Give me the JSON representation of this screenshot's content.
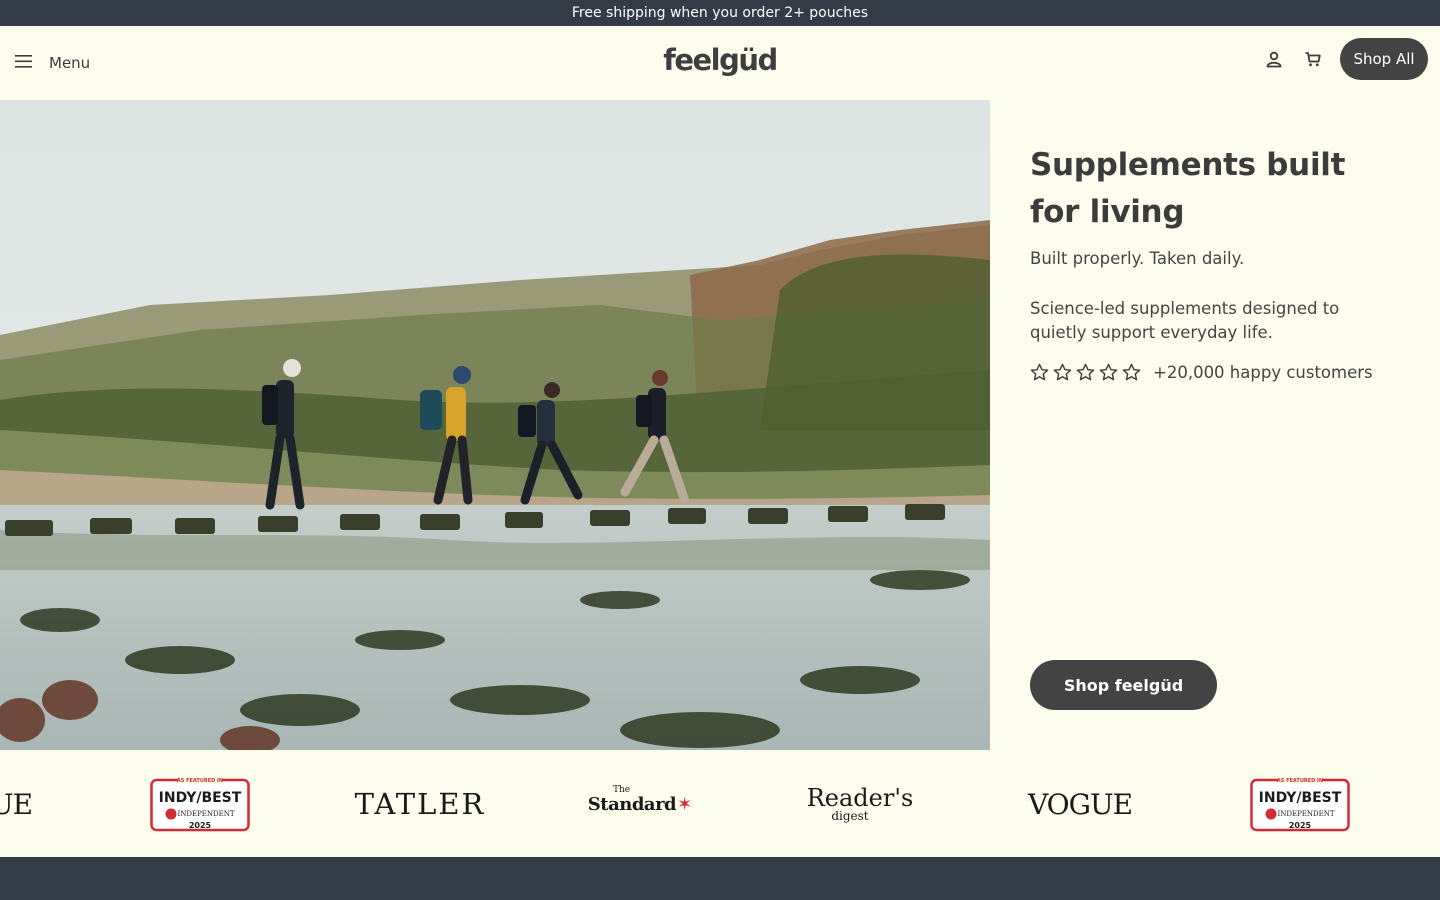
{
  "announcement": {
    "text": "Free shipping when you order 2+ pouches"
  },
  "header": {
    "menu_label": "Menu",
    "logo_text": "feelgüd",
    "shop_all_label": "Shop All",
    "icons": [
      "hamburger-icon",
      "account-icon",
      "cart-icon"
    ]
  },
  "hero": {
    "title": "Supplements built for living",
    "tagline": "Built properly. Taken daily.",
    "description": "Science-led supplements designed to quietly support everyday life.",
    "rating": {
      "stars_filled": 0,
      "stars_total": 5,
      "text": "+20,000 happy customers"
    },
    "cta_label": "Shop feelgüd"
  },
  "press_logos": {
    "vogue_partial": "UE",
    "indy_featured": "AS FEATURED IN",
    "indy_best": "INDY/BEST",
    "indy_publisher": "INDEPENDENT",
    "indy_year": "2025",
    "tatler": "TATLER",
    "standard_the": "The",
    "standard": "Standard",
    "readers": "Reader's",
    "readers_digest": "digest",
    "vogue": "VOGUE"
  },
  "colors": {
    "page_bg": "#fcfdec",
    "announce_bg": "#333b47",
    "button_bg": "#434343",
    "text": "#3c3c3c",
    "indy_red": "#d42a33"
  }
}
